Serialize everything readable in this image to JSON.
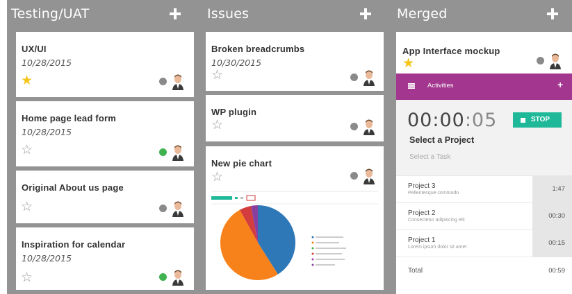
{
  "columns": [
    {
      "title": "Testing/UAT",
      "cards": [
        {
          "title": "UX/UI",
          "date": "10/28/2015",
          "starred": true,
          "status": "gray"
        },
        {
          "title": "Home page lead form",
          "date": "10/28/2015",
          "starred": false,
          "status": "green"
        },
        {
          "title": "Original About us page",
          "date": "",
          "starred": false,
          "status": "gray"
        },
        {
          "title": "Inspiration for calendar",
          "date": "10/28/2015",
          "starred": false,
          "status": "green"
        }
      ]
    },
    {
      "title": "Issues",
      "cards": [
        {
          "title": "Broken breadcrumbs",
          "date": "10/30/2015",
          "starred": false,
          "status": "gray"
        },
        {
          "title": "WP plugin",
          "date": "",
          "starred": false,
          "status": "gray"
        },
        {
          "title": "New pie chart",
          "date": "",
          "starred": false,
          "status": "gray"
        }
      ]
    },
    {
      "title": "Merged",
      "cards": [
        {
          "title": "App Interface mockup",
          "date": "",
          "starred": true,
          "status": "gray"
        }
      ]
    }
  ],
  "activities": {
    "label": "Activities",
    "timer_main": "00:00",
    "timer_sep": ":",
    "timer_seconds": "05",
    "stop_label": "STOP",
    "select_project": "Select a Project",
    "select_task": "Select a Task",
    "projects": [
      {
        "name": "Project 3",
        "desc": "Pellentesque commodo",
        "time": "1:47"
      },
      {
        "name": "Project 2",
        "desc": "Consectetur adipiscing elit",
        "time": "00:30"
      },
      {
        "name": "Project 1",
        "desc": "Lorem ipsum dolor sit amet",
        "time": "00:15"
      }
    ],
    "total_label": "Total",
    "total_value": "00:59"
  },
  "colors": {
    "status_gray": "#8a8a8a",
    "status_green": "#3fb34f",
    "activities_bar": "#a3368e",
    "stop_button": "#1fb99a",
    "star_filled": "#f5c518"
  },
  "pie_thumbnail": {
    "slices": [
      {
        "value": 41,
        "color": "#2f78b8"
      },
      {
        "value": 51,
        "color": "#f7821b"
      },
      {
        "value": 5,
        "color": "#d43d3d"
      },
      {
        "value": 3,
        "color": "#8a3f9e"
      }
    ]
  }
}
